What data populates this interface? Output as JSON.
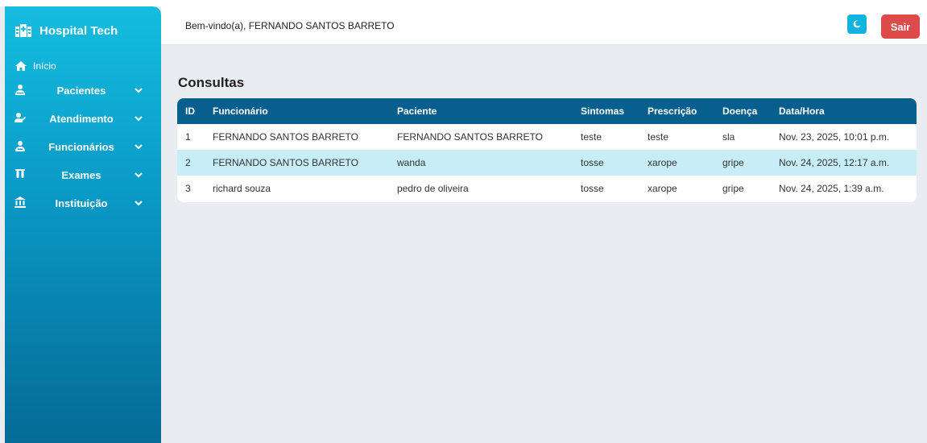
{
  "sidebar": {
    "brand": "Hospital Tech",
    "home": "Início",
    "items": [
      {
        "label": "Pacientes",
        "icon": "user-icon"
      },
      {
        "label": "Atendimento",
        "icon": "user-check-icon"
      },
      {
        "label": "Funcionários",
        "icon": "badge-icon"
      },
      {
        "label": "Exames",
        "icon": "vials-icon"
      },
      {
        "label": "Instituição",
        "icon": "institution-icon"
      }
    ]
  },
  "header": {
    "welcome": "Bem-vindo(a), FERNANDO SANTOS BARRETO",
    "theme_icon": "moon-icon",
    "logout_label": "Sair"
  },
  "main": {
    "title": "Consultas",
    "table": {
      "columns": [
        "ID",
        "Funcionário",
        "Paciente",
        "Sintomas",
        "Prescrição",
        "Doença",
        "Data/Hora"
      ],
      "rows": [
        [
          "1",
          "FERNANDO SANTOS BARRETO",
          "FERNANDO SANTOS BARRETO",
          "teste",
          "teste",
          "sla",
          "Nov. 23, 2025, 10:01 p.m."
        ],
        [
          "2",
          "FERNANDO SANTOS BARRETO",
          "wanda",
          "tosse",
          "xarope",
          "gripe",
          "Nov. 24, 2025, 12:17 a.m."
        ],
        [
          "3",
          "richard souza",
          "pedro de oliveira",
          "tosse",
          "xarope",
          "gripe",
          "Nov. 24, 2025, 1:39 a.m."
        ]
      ]
    }
  },
  "colors": {
    "sidebar_top": "#15bde0",
    "sidebar_bottom": "#066a96",
    "table_header": "#065f8c",
    "row_highlight": "#c7eef6",
    "logout": "#dc4a4a",
    "theme_button": "#13b4dc"
  }
}
